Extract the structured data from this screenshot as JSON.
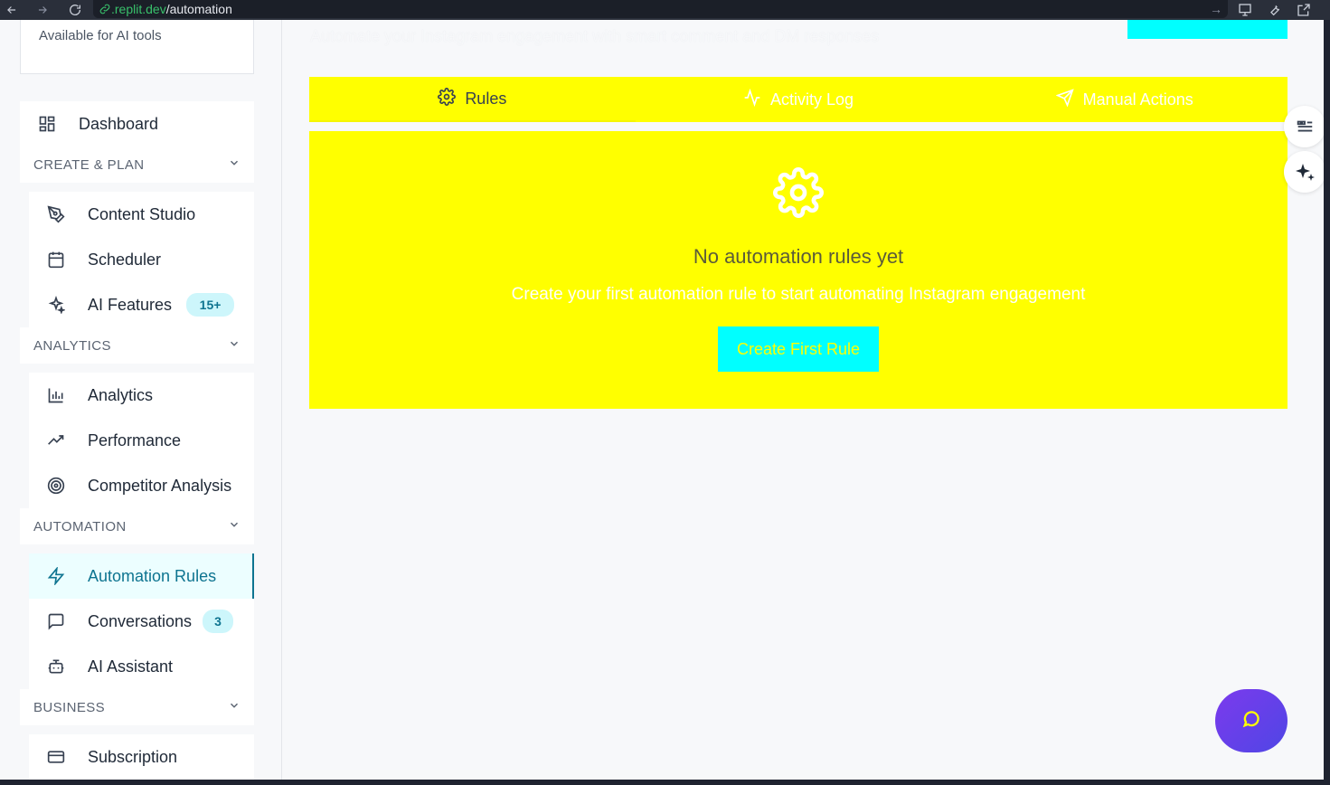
{
  "browser": {
    "url_host": ".replit.dev",
    "url_path": "/automation"
  },
  "sidebar": {
    "tools_caption": "Available for AI tools",
    "dashboard": "Dashboard",
    "sections": [
      {
        "title": "CREATE & PLAN",
        "items": [
          {
            "label": "Content Studio",
            "icon": "pen-tool-icon"
          },
          {
            "label": "Scheduler",
            "icon": "calendar-icon"
          },
          {
            "label": "AI Features",
            "icon": "sparkles-icon",
            "badge": "15+"
          }
        ]
      },
      {
        "title": "ANALYTICS",
        "items": [
          {
            "label": "Analytics",
            "icon": "bar-chart-icon"
          },
          {
            "label": "Performance",
            "icon": "trending-up-icon"
          },
          {
            "label": "Competitor Analysis",
            "icon": "target-icon"
          }
        ]
      },
      {
        "title": "AUTOMATION",
        "items": [
          {
            "label": "Automation Rules",
            "icon": "zap-icon",
            "active": true
          },
          {
            "label": "Conversations",
            "icon": "message-square-icon",
            "badge": "3"
          },
          {
            "label": "AI Assistant",
            "icon": "bot-icon"
          }
        ]
      },
      {
        "title": "BUSINESS",
        "items": [
          {
            "label": "Subscription",
            "icon": "credit-card-icon"
          }
        ]
      }
    ]
  },
  "main": {
    "subtitle": "Automate your Instagram engagement with smart comment and DM responses",
    "tabs": [
      {
        "label": "Rules",
        "icon": "gear-icon",
        "selected": true
      },
      {
        "label": "Activity Log",
        "icon": "activity-icon"
      },
      {
        "label": "Manual Actions",
        "icon": "send-icon"
      }
    ],
    "empty": {
      "title": "No automation rules yet",
      "message": "Create your first automation rule to start automating Instagram engagement",
      "button": "Create First Rule"
    }
  },
  "colors": {
    "accent_yellow": "#ffff00",
    "accent_cyan": "#00ffff",
    "active_teal": "#0e7490"
  }
}
